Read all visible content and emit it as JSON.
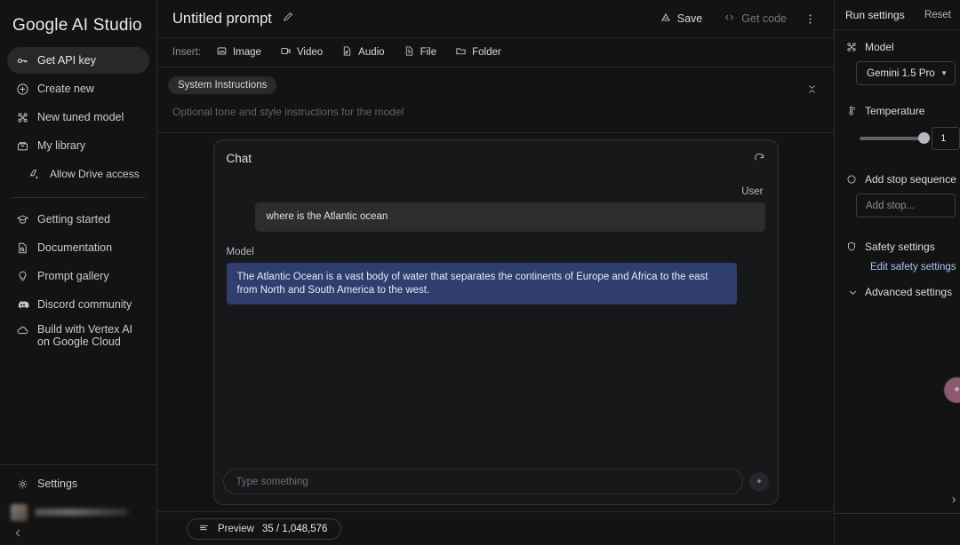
{
  "sidebar": {
    "brand": "Google AI Studio",
    "primary": [
      {
        "label": "Get API key",
        "icon": "key-icon",
        "active": true
      },
      {
        "label": "Create new",
        "icon": "plus-circle-icon",
        "active": false
      },
      {
        "label": "New tuned model",
        "icon": "tune-model-icon",
        "active": false
      },
      {
        "label": "My library",
        "icon": "library-icon",
        "active": false
      },
      {
        "label": "Allow Drive access",
        "icon": "drive-add-icon",
        "active": false,
        "sub": true
      }
    ],
    "secondary": [
      {
        "label": "Getting started",
        "icon": "graduation-cap-icon"
      },
      {
        "label": "Documentation",
        "icon": "document-search-icon"
      },
      {
        "label": "Prompt gallery",
        "icon": "lightbulb-icon"
      },
      {
        "label": "Discord community",
        "icon": "discord-icon"
      },
      {
        "label": "Build with Vertex AI on Google Cloud",
        "icon": "cloud-icon"
      }
    ],
    "settings_label": "Settings",
    "settings_icon": "gear-icon",
    "collapse_icon": "chevron-left-icon"
  },
  "topbar": {
    "prompt_title": "Untitled prompt",
    "edit_icon": "pencil-icon",
    "save_label": "Save",
    "save_icon": "drive-save-icon",
    "get_code_label": "Get code",
    "get_code_icon": "code-brackets-icon",
    "more_icon": "kebab-menu-icon"
  },
  "insertbar": {
    "label": "Insert:",
    "items": [
      {
        "label": "Image",
        "icon": "image-icon"
      },
      {
        "label": "Video",
        "icon": "video-icon"
      },
      {
        "label": "Audio",
        "icon": "audio-icon"
      },
      {
        "label": "File",
        "icon": "file-icon"
      },
      {
        "label": "Folder",
        "icon": "folder-icon"
      }
    ]
  },
  "system_instructions": {
    "pill_label": "System Instructions",
    "placeholder": "Optional tone and style instructions for the model",
    "collapse_icon": "collapse-chevrons-icon"
  },
  "chat": {
    "title": "Chat",
    "refresh_icon": "refresh-icon",
    "turns": [
      {
        "role_label": "User",
        "role": "user",
        "text": "where is the Atlantic ocean"
      },
      {
        "role_label": "Model",
        "role": "model",
        "text": "The Atlantic Ocean is a vast body of water that separates the continents of Europe and Africa to the east from North and South America to the west."
      }
    ],
    "input_placeholder": "Type something",
    "input_value": "",
    "send_icon": "sparkle-send-icon"
  },
  "bottombar": {
    "preview_label": "Preview",
    "preview_icon": "tune-lines-icon",
    "token_count": "35 / 1,048,576"
  },
  "run_settings": {
    "title": "Run settings",
    "reset_label": "Reset",
    "model": {
      "label": "Model",
      "icon": "model-icon",
      "selected": "Gemini 1.5 Pro",
      "caret_icon": "chevron-down-icon"
    },
    "temperature": {
      "label": "Temperature",
      "icon": "thermometer-icon",
      "value": "1",
      "slider_percent": 100
    },
    "stop_sequence": {
      "label": "Add stop sequence",
      "icon": "stop-circle-icon",
      "placeholder": "Add stop...",
      "value": ""
    },
    "safety": {
      "label": "Safety settings",
      "icon": "shield-icon",
      "link_label": "Edit safety settings"
    },
    "advanced": {
      "label": "Advanced settings",
      "icon": "chevron-down-icon"
    },
    "fab_icon": "assistant-fab-icon",
    "edge_chevron_icon": "chevron-right-icon"
  },
  "colors": {
    "background": "#131314",
    "panel_border": "#2a2b2d",
    "user_bubble": "#2c2d2f",
    "model_bubble": "#2f3e6e",
    "link": "#a8c7fa",
    "fab": "#8a5a70"
  }
}
